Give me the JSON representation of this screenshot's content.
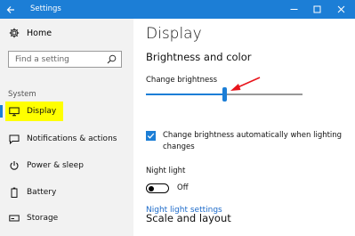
{
  "window": {
    "title": "Settings",
    "accent": "#1c7ed6"
  },
  "sidebar": {
    "home_label": "Home",
    "search_placeholder": "Find a setting",
    "section_label": "System",
    "items": [
      {
        "label": "Display",
        "icon": "monitor-icon",
        "active": true
      },
      {
        "label": "Notifications & actions",
        "icon": "notifications-icon",
        "active": false
      },
      {
        "label": "Power & sleep",
        "icon": "power-icon",
        "active": false
      },
      {
        "label": "Battery",
        "icon": "battery-icon",
        "active": false
      },
      {
        "label": "Storage",
        "icon": "storage-icon",
        "active": false
      }
    ]
  },
  "main": {
    "page_title": "Display",
    "section_brightness": "Brightness and color",
    "brightness_label": "Change brightness",
    "brightness_value": 0.5,
    "auto_brightness_checked": true,
    "auto_brightness_label": "Change brightness automatically when lighting changes",
    "night_light_label": "Night light",
    "night_light_state": "Off",
    "night_light_link": "Night light settings",
    "section_scale": "Scale and layout"
  }
}
